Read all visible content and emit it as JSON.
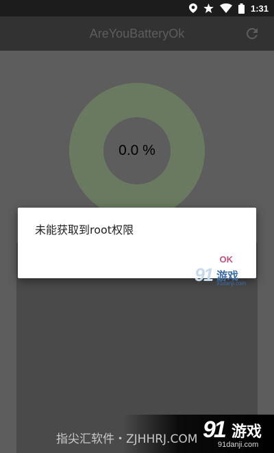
{
  "status_bar": {
    "time": "1:31",
    "icons": [
      "location-icon",
      "star-icon",
      "wifi-icon",
      "battery-icon"
    ]
  },
  "app_bar": {
    "title": "AreYouBatteryOk",
    "action_icon": "refresh-icon"
  },
  "battery": {
    "percent_text": "0.0 %"
  },
  "dialog": {
    "message": "未能获取到root权限",
    "ok_label": "OK"
  },
  "watermark": {
    "small_num": "91",
    "small_cn": "游戏",
    "small_url": "91danji.com",
    "footer_text": "指尖汇软件・ZJHHRJ.COM",
    "big_num": "91",
    "big_cn": "游戏",
    "big_url": "91danji.com"
  },
  "colors": {
    "status_bar": "#1c1c1c",
    "app_bar": "#323232",
    "donut": "#6a7a60",
    "ok_accent": "#c2507e"
  }
}
